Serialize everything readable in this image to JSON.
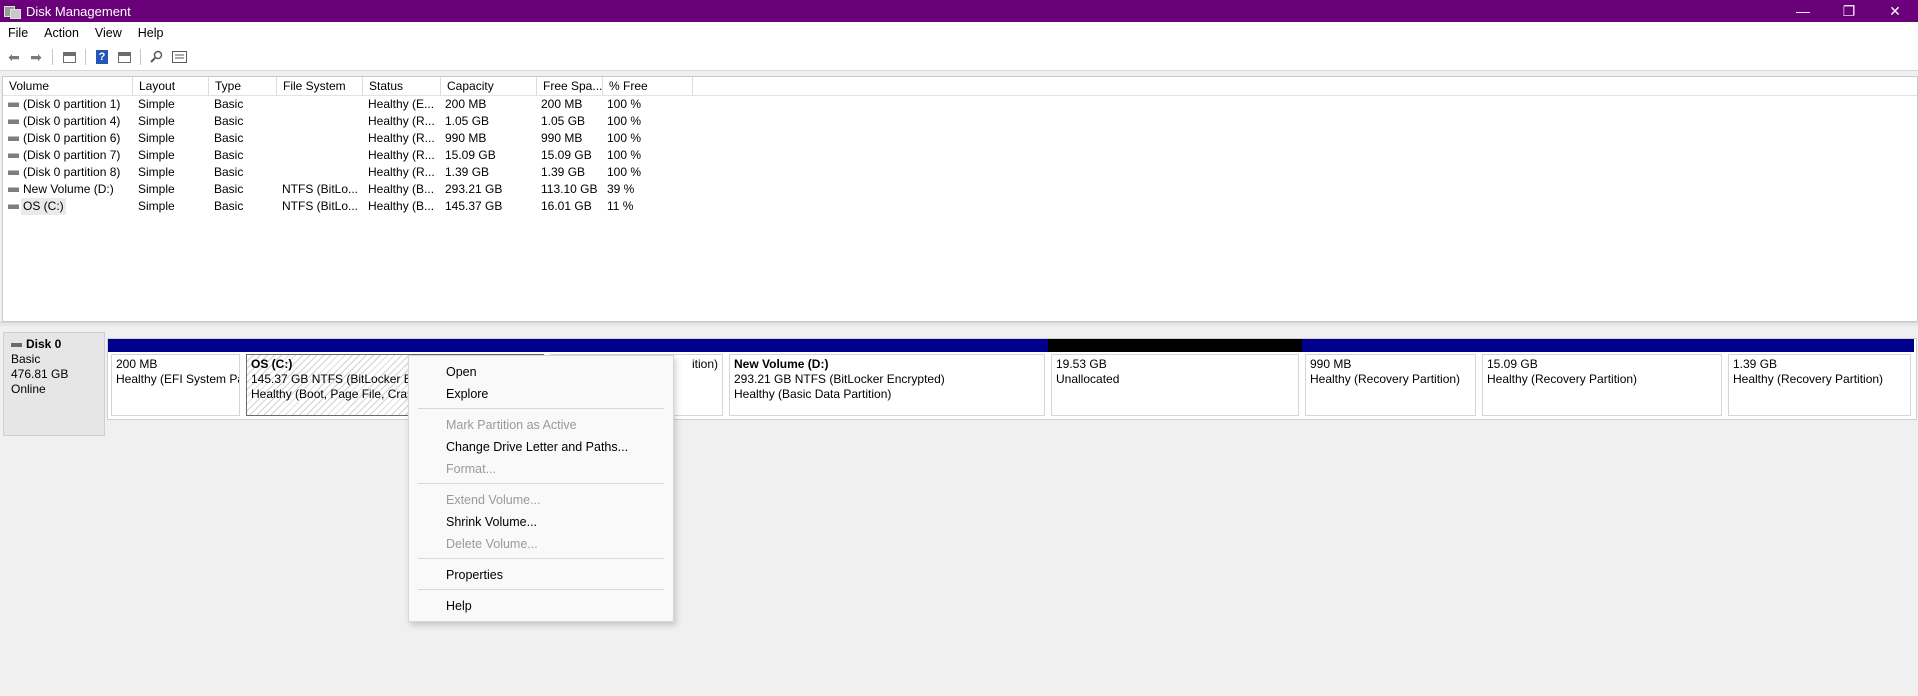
{
  "window": {
    "title": "Disk Management",
    "minimize_glyph": "—",
    "restore_glyph": "❐",
    "close_glyph": "✕"
  },
  "menubar": [
    "File",
    "Action",
    "View",
    "Help"
  ],
  "toolbar": {
    "icons": [
      "back-icon",
      "forward-icon",
      "disk-list-icon",
      "help-icon",
      "properties-icon",
      "connect-icon",
      "view-icon"
    ],
    "back_glyph": "⬅",
    "forward_glyph": "➡",
    "help_glyph": "?"
  },
  "volume_list": {
    "columns": [
      "Volume",
      "Layout",
      "Type",
      "File System",
      "Status",
      "Capacity",
      "Free Spa...",
      "% Free"
    ],
    "rows": [
      {
        "volume": "(Disk 0 partition 1)",
        "layout": "Simple",
        "type": "Basic",
        "fs": "",
        "status": "Healthy (E...",
        "capacity": "200 MB",
        "free": "200 MB",
        "pct": "100 %"
      },
      {
        "volume": "(Disk 0 partition 4)",
        "layout": "Simple",
        "type": "Basic",
        "fs": "",
        "status": "Healthy (R...",
        "capacity": "1.05 GB",
        "free": "1.05 GB",
        "pct": "100 %"
      },
      {
        "volume": "(Disk 0 partition 6)",
        "layout": "Simple",
        "type": "Basic",
        "fs": "",
        "status": "Healthy (R...",
        "capacity": "990 MB",
        "free": "990 MB",
        "pct": "100 %"
      },
      {
        "volume": "(Disk 0 partition 7)",
        "layout": "Simple",
        "type": "Basic",
        "fs": "",
        "status": "Healthy (R...",
        "capacity": "15.09 GB",
        "free": "15.09 GB",
        "pct": "100 %"
      },
      {
        "volume": "(Disk 0 partition 8)",
        "layout": "Simple",
        "type": "Basic",
        "fs": "",
        "status": "Healthy (R...",
        "capacity": "1.39 GB",
        "free": "1.39 GB",
        "pct": "100 %"
      },
      {
        "volume": "New Volume (D:)",
        "layout": "Simple",
        "type": "Basic",
        "fs": "NTFS (BitLo...",
        "status": "Healthy (B...",
        "capacity": "293.21 GB",
        "free": "113.10 GB",
        "pct": "39 %"
      },
      {
        "volume": "OS (C:)",
        "layout": "Simple",
        "type": "Basic",
        "fs": "NTFS (BitLo...",
        "status": "Healthy (B...",
        "capacity": "145.37 GB",
        "free": "16.01 GB",
        "pct": "11 %"
      }
    ]
  },
  "disk": {
    "name": "Disk 0",
    "type": "Basic",
    "size": "476.81 GB",
    "state": "Online",
    "partitions": [
      {
        "name": "",
        "size": "200 MB",
        "status": "Healthy (EFI System Pa"
      },
      {
        "name": "OS  (C:)",
        "size": "145.37 GB NTFS (BitLocker Enc",
        "status": "Healthy (Boot, Page File, Crash"
      },
      {
        "name": "",
        "size": "",
        "status": "ition)"
      },
      {
        "name": "New Volume  (D:)",
        "size": "293.21 GB NTFS (BitLocker Encrypted)",
        "status": "Healthy (Basic Data Partition)"
      },
      {
        "name": "",
        "size": "19.53 GB",
        "status": "Unallocated"
      },
      {
        "name": "",
        "size": "990 MB",
        "status": "Healthy (Recovery Partition)"
      },
      {
        "name": "",
        "size": "15.09 GB",
        "status": "Healthy (Recovery Partition)"
      },
      {
        "name": "",
        "size": "1.39 GB",
        "status": "Healthy (Recovery Partition)"
      }
    ]
  },
  "context_menu": {
    "items": [
      {
        "label": "Open",
        "enabled": true
      },
      {
        "label": "Explore",
        "enabled": true
      },
      {
        "label": "Mark Partition as Active",
        "enabled": false
      },
      {
        "label": "Change Drive Letter and Paths...",
        "enabled": true
      },
      {
        "label": "Format...",
        "enabled": false
      },
      {
        "label": "Extend Volume...",
        "enabled": false
      },
      {
        "label": "Shrink Volume...",
        "enabled": true
      },
      {
        "label": "Delete Volume...",
        "enabled": false
      },
      {
        "label": "Properties",
        "enabled": true
      },
      {
        "label": "Help",
        "enabled": true
      }
    ]
  },
  "colors": {
    "titlebar": "#6b007b",
    "partition_bar": "#00008b",
    "unallocated_bar": "#000000"
  }
}
